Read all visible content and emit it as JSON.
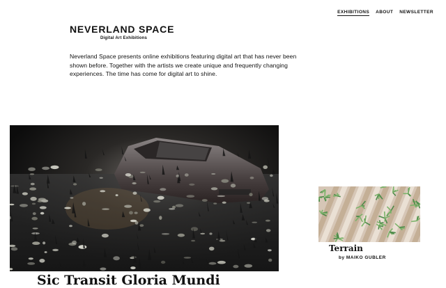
{
  "nav": {
    "items": [
      {
        "label": "EXHIBITIONS",
        "active": true
      },
      {
        "label": "ABOUT",
        "active": false
      },
      {
        "label": "NEWSLETTER",
        "active": false
      }
    ]
  },
  "brand": {
    "title": "NEVERLAND SPACE",
    "subtitle": "Digital Art Exhibitions"
  },
  "intro": {
    "text": "Neverland Space presents online exhibitions featuring digital art that has never been shown before. Together with the artists we create unique and frequently changing experiences. The time has come for digital art to shine."
  },
  "featured": {
    "title": "Sic Transit Gloria Mundi"
  },
  "card": {
    "title": "Terrain",
    "byline": "by MAIKO GUBLER"
  },
  "colors": {
    "text": "#111111",
    "background": "#ffffff",
    "feature_dark": "#141414",
    "card_tan": "#d6c6b6",
    "card_green": "#4e8a4a"
  }
}
